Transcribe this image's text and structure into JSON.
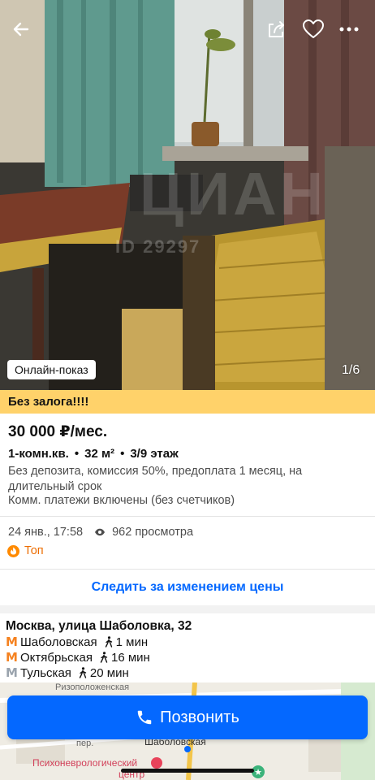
{
  "photo": {
    "badge": "Онлайн-показ",
    "counter": "1/6",
    "watermark_id": "ID 29297",
    "watermark_logo": "ЦИАН"
  },
  "header_icons": {
    "back": "arrow-left-icon",
    "share": "share-icon",
    "favorite": "heart-icon",
    "more": "more-icon"
  },
  "promo": "Без залога!!!!",
  "listing": {
    "price": "30 000 ₽/мес.",
    "rooms": "1-комн.кв.",
    "area": "32 м²",
    "floor": "3/9 этаж",
    "separator": "•",
    "description": "Без депозита, комиссия 50%, предоплата 1 месяц, на длительный срок",
    "utilities": "Комм. платежи включены (без счетчиков)"
  },
  "meta": {
    "date": "24 янв., 17:58",
    "views": "962 просмотра",
    "top_label": "Топ"
  },
  "track_price": "Следить за изменением цены",
  "location": {
    "address": "Москва, улица Шаболовка, 32",
    "metro": [
      {
        "symbol": "М",
        "name": "Шаболовская",
        "time": "1 мин",
        "color": "#f58220"
      },
      {
        "symbol": "М",
        "name": "Октябрьская",
        "time": "16 мин",
        "color": "#f58220"
      },
      {
        "symbol": "М",
        "name": "Тульская",
        "time": "20 мин",
        "color": "#9aa3ad"
      }
    ]
  },
  "map": {
    "street1": "Ризоположенская",
    "street2": "пер.",
    "station": "Шаболовская",
    "poi": "Психоневрологический",
    "poi2": "центр"
  },
  "call_button": "Позвонить",
  "colors": {
    "accent": "#0468ff",
    "promo_bg": "#ffd26a",
    "top_orange": "#ff8a00"
  }
}
